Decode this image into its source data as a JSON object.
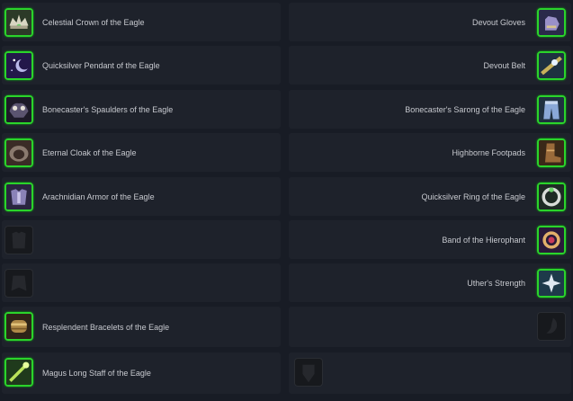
{
  "left_slots": [
    {
      "label": "Celestial Crown of the Eagle",
      "icon": "crown-icon",
      "filled": true
    },
    {
      "label": "Quicksilver Pendant of the Eagle",
      "icon": "pendant-icon",
      "filled": true
    },
    {
      "label": "Bonecaster's Spaulders of the Eagle",
      "icon": "spaulders-icon",
      "filled": true
    },
    {
      "label": "Eternal Cloak of the Eagle",
      "icon": "cloak-icon",
      "filled": true
    },
    {
      "label": "Arachnidian Armor of the Eagle",
      "icon": "armor-icon",
      "filled": true
    },
    {
      "label": "",
      "icon": "empty-shirt-slot-icon",
      "filled": false
    },
    {
      "label": "",
      "icon": "empty-tabard-slot-icon",
      "filled": false
    },
    {
      "label": "Resplendent Bracelets of the Eagle",
      "icon": "bracers-icon",
      "filled": true
    },
    {
      "label": "Magus Long Staff of the Eagle",
      "icon": "staff-icon",
      "filled": true
    }
  ],
  "right_slots": [
    {
      "label": "Devout Gloves",
      "icon": "gloves-icon",
      "filled": true
    },
    {
      "label": "Devout Belt",
      "icon": "belt-icon",
      "filled": true
    },
    {
      "label": "Bonecaster's Sarong of the Eagle",
      "icon": "legs-icon",
      "filled": true
    },
    {
      "label": "Highborne Footpads",
      "icon": "boots-icon",
      "filled": true
    },
    {
      "label": "Quicksilver Ring of the Eagle",
      "icon": "ring-icon",
      "filled": true
    },
    {
      "label": "Band of the Hierophant",
      "icon": "ring-icon",
      "filled": true
    },
    {
      "label": "Uther's Strength",
      "icon": "trinket-icon",
      "filled": true
    },
    {
      "label": "",
      "icon": "empty-trinket-slot-icon",
      "filled": false
    },
    {
      "label": "",
      "icon": "empty-offhand-slot-icon",
      "filled": false
    }
  ],
  "colors": {
    "background": "#181c25",
    "slot": "#1e222b",
    "text": "#c7c9cf",
    "uncommon_border": "#2bd42b"
  }
}
